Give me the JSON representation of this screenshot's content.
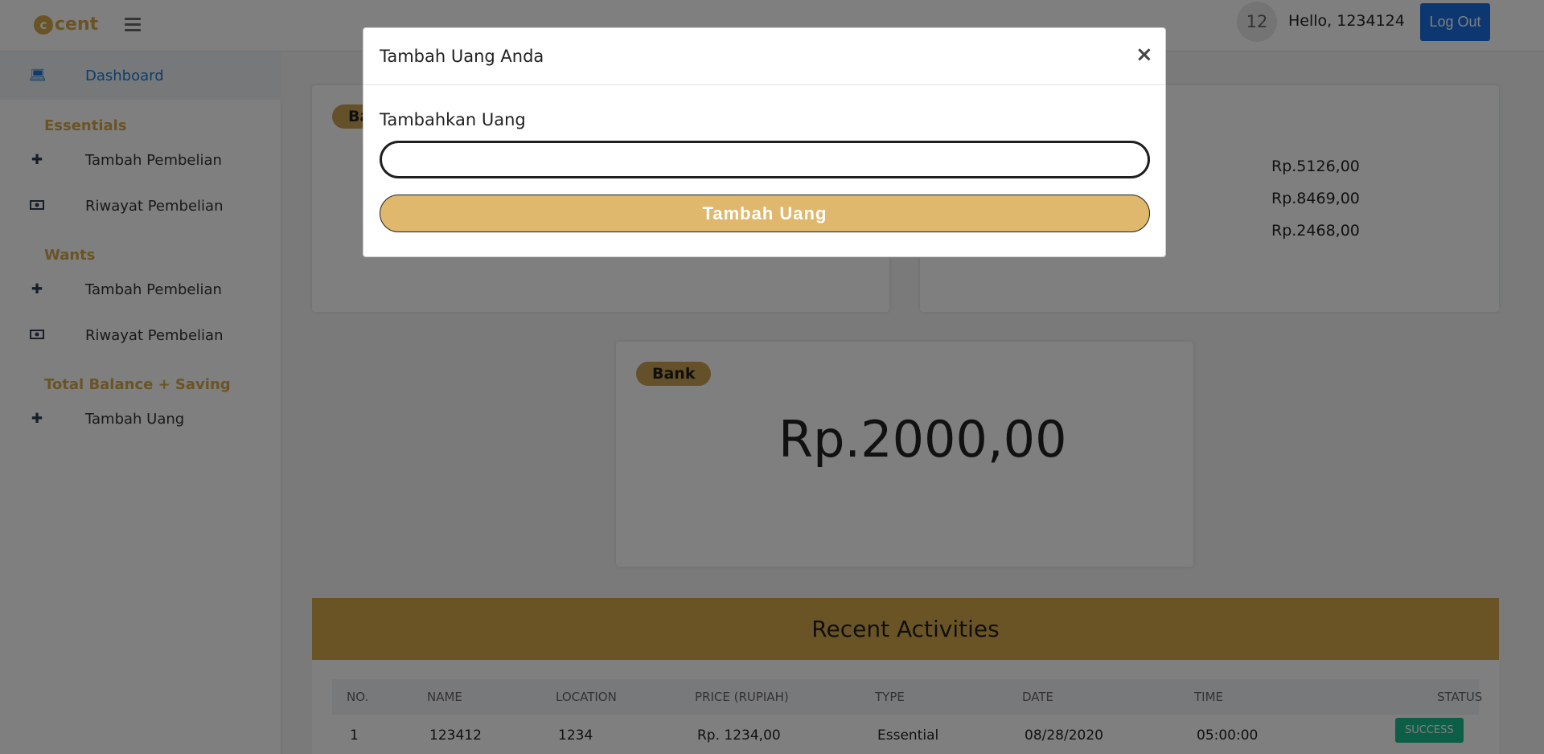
{
  "header": {
    "logo_text": "cent",
    "logo_mark": "c",
    "avatar_text": "12",
    "greeting": "Hello, 1234124",
    "logout_label": "Log Out"
  },
  "sidebar": {
    "dashboard": "Dashboard",
    "sections": [
      {
        "heading": "Essentials",
        "items": [
          {
            "icon": "plus-icon",
            "label": "Tambah Pembelian"
          },
          {
            "icon": "money-icon",
            "label": "Riwayat Pembelian"
          }
        ]
      },
      {
        "heading": "Wants",
        "items": [
          {
            "icon": "plus-icon",
            "label": "Tambah Pembelian"
          },
          {
            "icon": "money-icon",
            "label": "Riwayat Pembelian"
          }
        ]
      },
      {
        "heading": "Total Balance + Saving",
        "items": [
          {
            "icon": "plus-icon",
            "label": "Tambah Uang"
          }
        ]
      }
    ]
  },
  "main": {
    "card_left_badge": "Ba",
    "amounts_right": [
      "Rp.5126,00",
      "Rp.8469,00",
      "Rp.2468,00"
    ],
    "bank_badge": "Bank",
    "bank_amount": "Rp.2000,00",
    "activities_title": "Recent Activities",
    "table": {
      "headers": [
        "NO.",
        "NAME",
        "LOCATION",
        "PRICE (RUPIAH)",
        "TYPE",
        "DATE",
        "TIME",
        "STATUS"
      ],
      "rows": [
        {
          "no": "1",
          "name": "123412",
          "location": "1234",
          "price": "Rp. 1234,00",
          "type": "Essential",
          "date": "08/28/2020",
          "time": "05:00:00",
          "status": "SUCCESS"
        }
      ]
    }
  },
  "modal": {
    "title": "Tambah Uang Anda",
    "close_symbol": "×",
    "field_label": "Tambahkan Uang",
    "input_value": "",
    "submit_label": "Tambah Uang"
  },
  "colors": {
    "accent_gold": "#d4a94a",
    "button_blue": "#1a6fe0",
    "success_green": "#1abc8c"
  }
}
